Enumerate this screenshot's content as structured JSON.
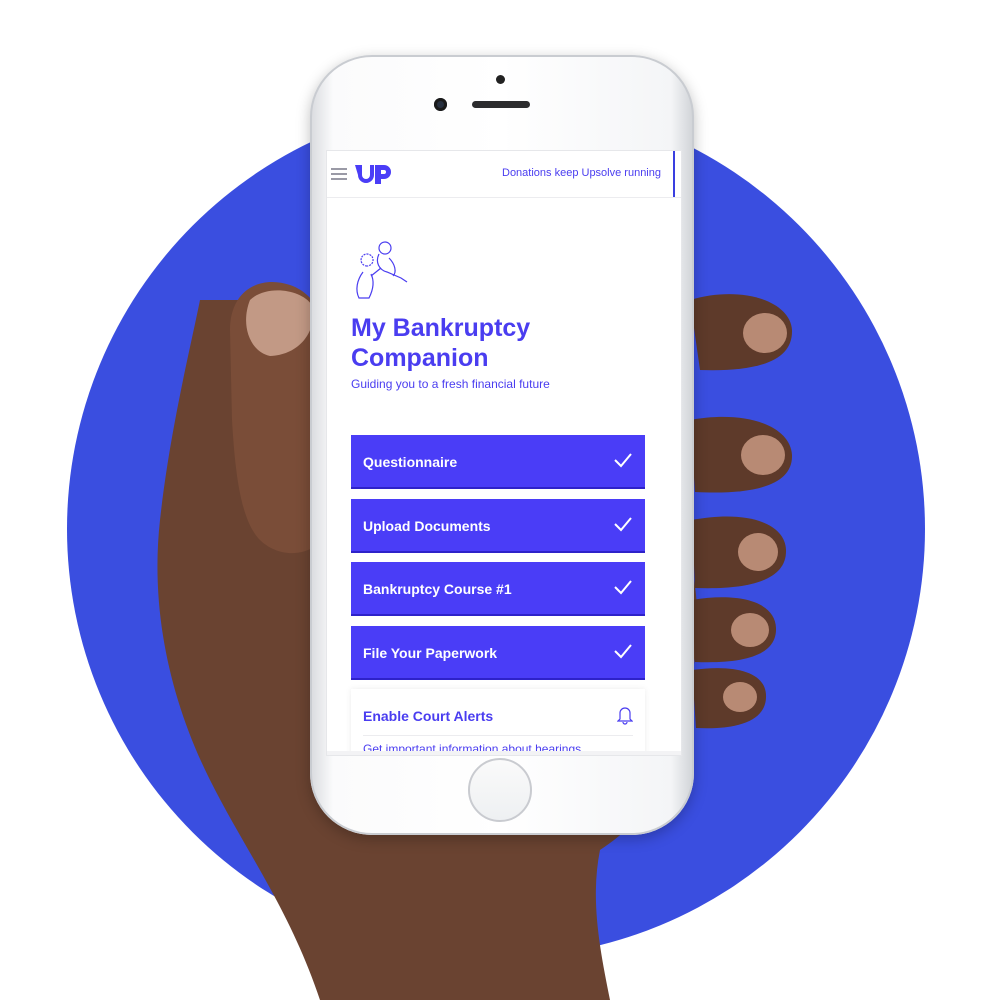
{
  "header": {
    "donations_text": "Donations keep Upsolve running",
    "logo_icon": "upsolve-logo-icon",
    "menu_icon": "hamburger-menu-icon"
  },
  "hero": {
    "title": "My Bankruptcy Companion",
    "subtitle": "Guiding you to a fresh financial future",
    "illustration_icon": "helping-hand-illustration"
  },
  "steps": [
    {
      "label": "Questionnaire",
      "status": "complete",
      "icon": "checkmark-icon"
    },
    {
      "label": "Upload Documents",
      "status": "complete",
      "icon": "checkmark-icon"
    },
    {
      "label": "Bankruptcy Course #1",
      "status": "complete",
      "icon": "checkmark-icon"
    },
    {
      "label": "File Your Paperwork",
      "status": "complete",
      "icon": "checkmark-icon"
    }
  ],
  "alert_card": {
    "title": "Enable Court Alerts",
    "text": "Get important information about hearings,",
    "icon": "bell-icon"
  },
  "colors": {
    "brand": "#4a3df7",
    "background_circle": "#3a4ee0",
    "text_on_brand": "#ffffff"
  }
}
